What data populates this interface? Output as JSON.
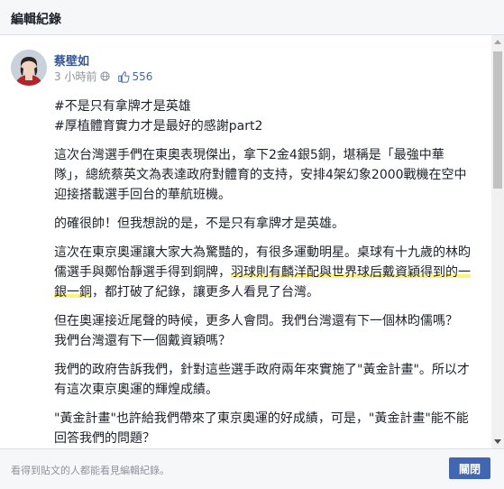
{
  "dialog": {
    "title": "編輯紀錄"
  },
  "post": {
    "author": "蔡壁如",
    "timestamp": "3 小時前",
    "privacy_icon": "globe-icon",
    "likes": "556",
    "hashtag1": "#不是只有拿牌才是英雄",
    "hashtag2": "#厚植體育實力才是最好的感謝part2",
    "p1": "這次台灣選手們在東奧表現傑出，拿下2金4銀5銅，堪稱是「最強中華隊」，總統蔡英文為表達政府對體育的支持，安排4架幻象2000戰機在空中迎接搭載選手回台的華航班機。",
    "p2": "的確很帥！但我想說的是，不是只有拿牌才是英雄。",
    "p3_a": "這次在東京奧運讓大家大為驚豔的，有很多運動明星。桌球有十九歲的林昀儒選手與鄭怡靜選手得到銅牌，",
    "p3_hl": "羽球則有麟洋配與世界球后戴資穎得到的一銀一銅",
    "p3_b": "，都打破了紀錄，讓更多人看見了台灣。",
    "p4_l1": "但在奧運接近尾聲的時候，更多人會問。我們台灣還有下一個林昀儒嗎？",
    "p4_l2": "我們台灣還有下一個戴資穎嗎？",
    "p5": "我們的政府告訴我們，針對這些選手政府兩年來實施了\"黃金計畫\"。所以才有這次東京奧運的輝煌成績。",
    "p6": "\"黃金計畫\"也許給我們帶來了東京奧運的好成績，可是，\"黃金計畫\"能不能回答我們的問題？"
  },
  "footer": {
    "note": "看得到貼文的人都能看見編輯紀錄。",
    "close_label": "關閉"
  },
  "colors": {
    "accent": "#4267b2",
    "link": "#365899",
    "highlight": "#fff27a"
  }
}
